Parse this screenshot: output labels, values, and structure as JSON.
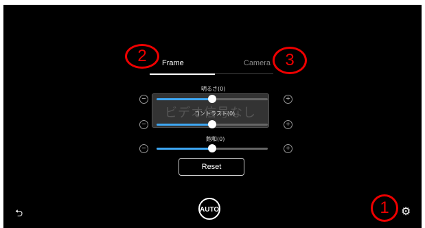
{
  "tabs": {
    "frame": "Frame",
    "camera": "Camera"
  },
  "overlay": {
    "no_signal": "ビデオ信号なし"
  },
  "sliders": [
    {
      "label": "明るさ(0)",
      "value": 0.5
    },
    {
      "label": "コントラスト(0)",
      "value": 0.5
    },
    {
      "label": "飽和(0)",
      "value": 0.5
    }
  ],
  "buttons": {
    "minus": "−",
    "plus": "+",
    "reset": "Reset",
    "auto": "AUTO"
  },
  "icons": {
    "back": "back-arrow-icon",
    "settings": "gear-icon"
  },
  "annotations": {
    "one": "1",
    "two": "2",
    "three": "3"
  },
  "colors": {
    "slider_fill": "#3ea8f5",
    "annotation": "#e00000"
  }
}
